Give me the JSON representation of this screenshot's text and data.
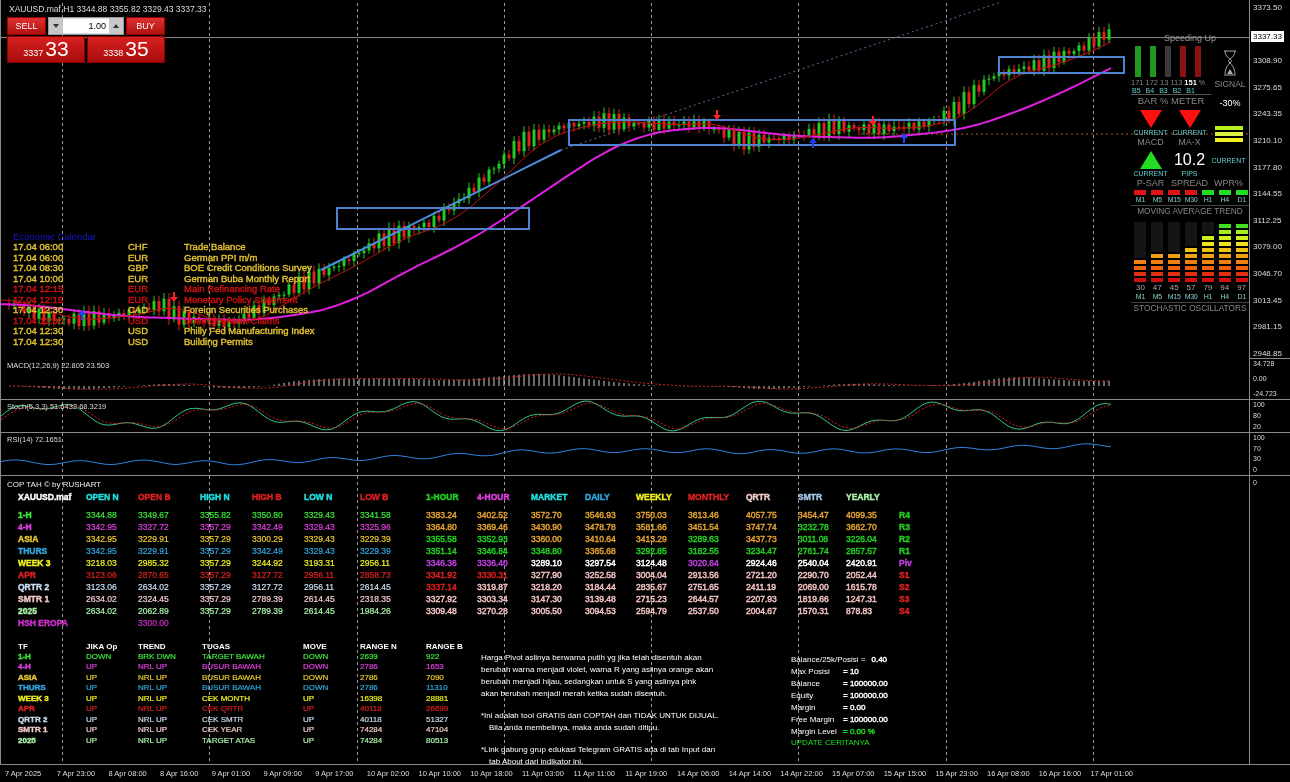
{
  "chart": {
    "symbol": "XAUUSD.maf,H1",
    "ohlc": "3344.88 3355.82 3329.43 3337.33",
    "current_price": "3337.33",
    "price_axis": [
      "3373.50",
      "3308.90",
      "3275.65",
      "3243.35",
      "3210.10",
      "3177.80",
      "3144.55",
      "3112.25",
      "3079.00",
      "3046.70",
      "3013.45",
      "2981.15",
      "2948.85"
    ]
  },
  "trade": {
    "sell": "SELL",
    "buy": "BUY",
    "lot": "1.00",
    "bid_main": "3337",
    "bid_big": "33",
    "ask_main": "3338",
    "ask_big": "35"
  },
  "calendar": {
    "title": "Economic Calendar",
    "events": [
      {
        "time": "17.04 06:00",
        "currency": "CHF",
        "event": "Trade Balance",
        "color": "#e0c030"
      },
      {
        "time": "17.04 06:00",
        "currency": "EUR",
        "event": "German PPI m/m",
        "color": "#e0c030"
      },
      {
        "time": "17.04 08:30",
        "currency": "GBP",
        "event": "BOE Credit Conditions Survey",
        "color": "#e0c030"
      },
      {
        "time": "17.04 10:00",
        "currency": "EUR",
        "event": "German Buba Monthly Report",
        "color": "#e0c030"
      },
      {
        "time": "17.04 12:15",
        "currency": "EUR",
        "event": "Main Refinancing Rate",
        "color": "#d01010"
      },
      {
        "time": "17.04 12:15",
        "currency": "EUR",
        "event": "Monetary Policy Statement",
        "color": "#d01010"
      },
      {
        "time": "17.04 12:30",
        "currency": "CAD",
        "event": "Foreign Securities Purchases",
        "color": "#e0c030"
      },
      {
        "time": "17.04 12:30",
        "currency": "USD",
        "event": "Unemployment Claims",
        "color": "#d01010"
      },
      {
        "time": "17.04 12:30",
        "currency": "USD",
        "event": "Philly Fed Manufacturing Index",
        "color": "#e0c030"
      },
      {
        "time": "17.04 12:30",
        "currency": "USD",
        "event": "Building Permits",
        "color": "#e0c030"
      }
    ]
  },
  "dashboard": {
    "status": "Speeding Up",
    "bar_meter": {
      "title": "BAR % METER",
      "unit": "%",
      "bars": [
        {
          "label": "B5",
          "value": "171",
          "color": "#1f9a1f",
          "highlight": false
        },
        {
          "label": "B4",
          "value": "172",
          "color": "#1f9a1f",
          "highlight": false
        },
        {
          "label": "B3",
          "value": "13",
          "color": "#3a3a3a",
          "highlight": false
        },
        {
          "label": "B2",
          "value": "113",
          "color": "#8a1212",
          "highlight": false
        },
        {
          "label": "B1",
          "value": "151",
          "color": "#8a1212",
          "highlight": true
        }
      ]
    },
    "signal": {
      "label": "SIGNAL",
      "value": "-30%"
    },
    "signals": [
      {
        "kind": "arrow",
        "rising": false,
        "caption": "CURRENT",
        "name": "MACD"
      },
      {
        "kind": "arrow",
        "rising": false,
        "caption": "CURRENT",
        "name": "MA-X"
      },
      {
        "kind": "arrow",
        "rising": true,
        "caption": "CURRENT",
        "name": "P-SAR"
      },
      {
        "kind": "value",
        "value": "10.2",
        "caption": "PIPS",
        "name": "SPREAD"
      },
      {
        "kind": "stripes",
        "caption": "CURRENT",
        "name": "WPR%"
      }
    ],
    "ma_trend": {
      "title": "MOVING AVERAGE TREND",
      "frames": [
        {
          "label": "M1",
          "color": "#e01515"
        },
        {
          "label": "M5",
          "color": "#e01515"
        },
        {
          "label": "M15",
          "color": "#e01515"
        },
        {
          "label": "M30",
          "color": "#e01515"
        },
        {
          "label": "H1",
          "color": "#22dd22"
        },
        {
          "label": "H4",
          "color": "#22dd22"
        },
        {
          "label": "D1",
          "color": "#22dd22"
        }
      ]
    },
    "stochastic": {
      "title": "STOCHASTIC OSCILLATORS",
      "frames": [
        {
          "label": "M1",
          "value": "30",
          "level": 0.4
        },
        {
          "label": "M5",
          "value": "47",
          "level": 0.5
        },
        {
          "label": "M15",
          "value": "45",
          "level": 0.5
        },
        {
          "label": "M30",
          "value": "57",
          "level": 0.6
        },
        {
          "label": "H1",
          "value": "79",
          "level": 0.8
        },
        {
          "label": "H4",
          "value": "94",
          "level": 1.0
        },
        {
          "label": "D1",
          "value": "97",
          "level": 1.0
        }
      ]
    }
  },
  "indicators": [
    {
      "kind": "macd",
      "label": "MACD(12,26,9) 22.805 23.503",
      "axis": [
        "34.728",
        "0.00",
        "-24.723"
      ]
    },
    {
      "kind": "stoch",
      "label": "Stoch(5,3,3) 51.6432 68.3219",
      "axis": [
        "100",
        "80",
        "20"
      ]
    },
    {
      "kind": "rsi",
      "label": "RSI(14) 72.1651",
      "axis": [
        "100",
        "70",
        "30",
        "0"
      ]
    }
  ],
  "pivot_table": {
    "title": "COP TAH © by RUSHART",
    "columns": [
      {
        "label": "XAUUSD.maf",
        "color": "#ffffff"
      },
      {
        "label": "OPEN N",
        "color": "#20e0e0"
      },
      {
        "label": "OPEN B",
        "color": "#e02020"
      },
      {
        "label": "HIGH N",
        "color": "#20e0e0"
      },
      {
        "label": "HIGH B",
        "color": "#e02020"
      },
      {
        "label": "LOW N",
        "color": "#20e0e0"
      },
      {
        "label": "LOW B",
        "color": "#e02020"
      },
      {
        "label": "1-HOUR",
        "color": "#20d020"
      },
      {
        "label": "4-HOUR",
        "color": "#e040e0"
      },
      {
        "label": "MARKET",
        "color": "#20e0e0"
      },
      {
        "label": "DAILY",
        "color": "#30a8e0"
      },
      {
        "label": "WEEKLY",
        "color": "#f0f020"
      },
      {
        "label": "MONTHLY",
        "color": "#e02020"
      },
      {
        "label": "QRTR",
        "color": "#f0c8c8"
      },
      {
        "label": "SMTR",
        "color": "#a8c8f0"
      },
      {
        "label": "YEARLY",
        "color": "#a8f0a8"
      }
    ],
    "rows": [
      {
        "label": "1-H",
        "color": "#3ce63c",
        "values": [
          "3344.88",
          "3349.67",
          "3355.82",
          "3350.80",
          "3329.43",
          "3341.58"
        ],
        "pivots": [
          {
            "value": "3383.24",
            "color": "#e0a030"
          },
          {
            "value": "3402.52",
            "color": "#e0a030"
          },
          {
            "value": "3572.70",
            "color": "#e0a030"
          },
          {
            "value": "3546.93",
            "color": "#e0a030"
          },
          {
            "value": "3750.03",
            "color": "#e0a030"
          },
          {
            "value": "3613.46",
            "color": "#e0a030"
          },
          {
            "value": "4057.75",
            "color": "#e0a030"
          },
          {
            "value": "3454.47",
            "color": "#e0a030"
          },
          {
            "value": "4099.35",
            "color": "#e0a030"
          }
        ],
        "level": {
          "text": "R4",
          "color": "#20d020"
        }
      },
      {
        "label": "4-H",
        "color": "#e040e0",
        "values": [
          "3342.95",
          "3327.72",
          "3357.29",
          "3342.49",
          "3329.43",
          "3325.96"
        ],
        "pivots": [
          {
            "value": "3364.80",
            "color": "#e0a030"
          },
          {
            "value": "3369.46",
            "color": "#e0a030"
          },
          {
            "value": "3430.90",
            "color": "#e0a030"
          },
          {
            "value": "3478.78",
            "color": "#e0a030"
          },
          {
            "value": "3581.66",
            "color": "#e0a030"
          },
          {
            "value": "3451.54",
            "color": "#e0a030"
          },
          {
            "value": "3747.74",
            "color": "#e0a030"
          },
          {
            "value": "3232.78",
            "color": "#20d020"
          },
          {
            "value": "3662.70",
            "color": "#e0a030"
          }
        ],
        "level": {
          "text": "R3",
          "color": "#20d020"
        }
      },
      {
        "label": "ASIA",
        "color": "#e8c830",
        "values": [
          "3342.95",
          "3229.91",
          "3357.29",
          "3300.29",
          "3329.43",
          "3229.39"
        ],
        "pivots": [
          {
            "value": "3355.58",
            "color": "#20d020"
          },
          {
            "value": "3352.93",
            "color": "#20d020"
          },
          {
            "value": "3360.00",
            "color": "#e0a030"
          },
          {
            "value": "3410.64",
            "color": "#e0a030"
          },
          {
            "value": "3413.29",
            "color": "#e0a030"
          },
          {
            "value": "3289.63",
            "color": "#20d020"
          },
          {
            "value": "3437.73",
            "color": "#e0a030"
          },
          {
            "value": "3011.08",
            "color": "#20d020"
          },
          {
            "value": "3226.04",
            "color": "#20d020"
          }
        ],
        "level": {
          "text": "R2",
          "color": "#20d020"
        }
      },
      {
        "label": "THURS",
        "color": "#30a8e0",
        "values": [
          "3342.95",
          "3229.91",
          "3357.29",
          "3342.49",
          "3329.43",
          "3229.39"
        ],
        "pivots": [
          {
            "value": "3351.14",
            "color": "#20d020"
          },
          {
            "value": "3346.84",
            "color": "#20d020"
          },
          {
            "value": "3348.80",
            "color": "#20d020"
          },
          {
            "value": "3365.68",
            "color": "#e0a030"
          },
          {
            "value": "3292.85",
            "color": "#20d020"
          },
          {
            "value": "3182.55",
            "color": "#20d020"
          },
          {
            "value": "3234.47",
            "color": "#20d020"
          },
          {
            "value": "2761.74",
            "color": "#20d020"
          },
          {
            "value": "2857.57",
            "color": "#20d020"
          }
        ],
        "level": {
          "text": "R1",
          "color": "#20d020"
        }
      },
      {
        "label": "WEEK 3",
        "color": "#f0f020",
        "values": [
          "3218.03",
          "2985.32",
          "3357.29",
          "3244.92",
          "3193.31",
          "2956.11"
        ],
        "pivots": [
          {
            "value": "3346.36",
            "color": "#c040e0"
          },
          {
            "value": "3336.40",
            "color": "#c040e0"
          },
          {
            "value": "3289.10",
            "color": "#ffffff"
          },
          {
            "value": "3297.54",
            "color": "#ffffff"
          },
          {
            "value": "3124.48",
            "color": "#ffffff"
          },
          {
            "value": "3020.64",
            "color": "#c040e0"
          },
          {
            "value": "2924.46",
            "color": "#ffffff"
          },
          {
            "value": "2540.04",
            "color": "#ffffff"
          },
          {
            "value": "2420.91",
            "color": "#ffffff"
          }
        ],
        "level": {
          "text": "Piv",
          "color": "#c040e0"
        }
      },
      {
        "label": "APR",
        "color": "#e02020",
        "values": [
          "3123.06",
          "2870.65",
          "3357.29",
          "3127.72",
          "2956.11",
          "2858.73"
        ],
        "pivots": [
          {
            "value": "3341.92",
            "color": "#e02020"
          },
          {
            "value": "3330.31",
            "color": "#e02020"
          },
          {
            "value": "3277.90",
            "color": "#f0c0c0"
          },
          {
            "value": "3252.58",
            "color": "#f0c0c0"
          },
          {
            "value": "3004.04",
            "color": "#f0c0c0"
          },
          {
            "value": "2913.56",
            "color": "#f0c0c0"
          },
          {
            "value": "2721.20",
            "color": "#f0c0c0"
          },
          {
            "value": "2290.70",
            "color": "#f0c0c0"
          },
          {
            "value": "2052.44",
            "color": "#f0c0c0"
          }
        ],
        "level": {
          "text": "S1",
          "color": "#e02020"
        }
      },
      {
        "label": "QRTR 2",
        "color": "#c8dcf0",
        "values": [
          "3123.06",
          "2634.02",
          "3357.29",
          "3127.72",
          "2956.11",
          "2614.45"
        ],
        "pivots": [
          {
            "value": "3337.14",
            "color": "#e02020"
          },
          {
            "value": "3319.87",
            "color": "#f0c0c0"
          },
          {
            "value": "3218.20",
            "color": "#f0c0c0"
          },
          {
            "value": "3184.44",
            "color": "#f0c0c0"
          },
          {
            "value": "2835.67",
            "color": "#f0c0c0"
          },
          {
            "value": "2751.65",
            "color": "#f0c0c0"
          },
          {
            "value": "2411.19",
            "color": "#f0c0c0"
          },
          {
            "value": "2069.00",
            "color": "#f0c0c0"
          },
          {
            "value": "1615.78",
            "color": "#f0c0c0"
          }
        ],
        "level": {
          "text": "S2",
          "color": "#e02020"
        }
      },
      {
        "label": "SMTR 1",
        "color": "#f0c8c8",
        "values": [
          "2634.02",
          "2324.45",
          "3357.29",
          "2789.39",
          "2614.45",
          "2318.35"
        ],
        "pivots": [
          {
            "value": "3327.92",
            "color": "#f0c0c0"
          },
          {
            "value": "3303.34",
            "color": "#f0c0c0"
          },
          {
            "value": "3147.30",
            "color": "#f0c0c0"
          },
          {
            "value": "3139.48",
            "color": "#f0c0c0"
          },
          {
            "value": "2715.23",
            "color": "#f0c0c0"
          },
          {
            "value": "2644.57",
            "color": "#f0c0c0"
          },
          {
            "value": "2207.93",
            "color": "#f0c0c0"
          },
          {
            "value": "1819.66",
            "color": "#f0c0c0"
          },
          {
            "value": "1247.31",
            "color": "#f0c0c0"
          }
        ],
        "level": {
          "text": "S3",
          "color": "#e02020"
        }
      },
      {
        "label": "2025",
        "color": "#a8f0a8",
        "values": [
          "2634.02",
          "2062.89",
          "3357.29",
          "2789.39",
          "2614.45",
          "1984.26"
        ],
        "pivots": [
          {
            "value": "3309.48",
            "color": "#f0c0c0"
          },
          {
            "value": "3270.28",
            "color": "#f0c0c0"
          },
          {
            "value": "3005.50",
            "color": "#f0c0c0"
          },
          {
            "value": "3094.53",
            "color": "#f0c0c0"
          },
          {
            "value": "2594.79",
            "color": "#f0c0c0"
          },
          {
            "value": "2537.50",
            "color": "#f0c0c0"
          },
          {
            "value": "2004.67",
            "color": "#f0c0c0"
          },
          {
            "value": "1570.31",
            "color": "#f0c0c0"
          },
          {
            "value": "878.83",
            "color": "#f0c0c0"
          }
        ],
        "level": {
          "text": "S4",
          "color": "#e02020"
        }
      },
      {
        "label": "HSH EROPA",
        "color": "#d030d0",
        "open_b": "3300.00"
      }
    ]
  },
  "plan_table": {
    "columns": [
      "TF",
      "JIKA Op",
      "TREND",
      "TUGAS",
      "MOVE",
      "RANGE N",
      "RANGE B"
    ],
    "rows": [
      {
        "color": "#3ce63c",
        "cells": [
          "1-H",
          "DOWN",
          "BRK DWN",
          "TARGET BAWAH",
          "DOWN",
          "2639",
          "922"
        ]
      },
      {
        "color": "#e040e0",
        "cells": [
          "4-H",
          "UP",
          "NRL UP",
          "BUSUR BAWAH",
          "DOWN",
          "2786",
          "1653"
        ]
      },
      {
        "color": "#e8c830",
        "cells": [
          "ASIA",
          "UP",
          "NRL UP",
          "BUSUR BAWAH",
          "DOWN",
          "2786",
          "7090"
        ]
      },
      {
        "color": "#30a8e0",
        "cells": [
          "THURS",
          "UP",
          "NRL UP",
          "BUSUR BAWAH",
          "DOWN",
          "2786",
          "11310"
        ]
      },
      {
        "color": "#f0f020",
        "cells": [
          "WEEK 3",
          "UP",
          "NRL UP",
          "CEK MONTH",
          "UP",
          "16398",
          "28881"
        ]
      },
      {
        "color": "#e02020",
        "cells": [
          "APR",
          "UP",
          "NRL UP",
          "CEK QRTR",
          "UP",
          "40118",
          "26699"
        ]
      },
      {
        "color": "#c8dcf0",
        "cells": [
          "QRTR 2",
          "UP",
          "NRL UP",
          "CEK SMTR",
          "UP",
          "40118",
          "51327"
        ]
      },
      {
        "color": "#f0c8c8",
        "cells": [
          "SMTR 1",
          "UP",
          "NRL UP",
          "CEK YEAR",
          "UP",
          "74284",
          "47104"
        ]
      },
      {
        "color": "#a8f0a8",
        "cells": [
          "2025",
          "UP",
          "NRL UP",
          "TARGET ATAS",
          "UP",
          "74284",
          "80513"
        ]
      }
    ]
  },
  "notes": [
    {
      "hanging": false,
      "lines": [
        "Harga Pivot aslinya berwarna putih yg jika telah disentuh akan",
        "berubah warna menjadi violet, warna R yang aslinya orange akan",
        "berubah menjadi hijau, sedangkan untuk S yang aslinya pink",
        "akan berubah menjadi merah ketika sudah disentuh."
      ]
    },
    {
      "hanging": true,
      "lines": [
        "*Ini adalah tool GRATIS dari COPTAH dan TIDAK UNTUK DIJUAL.",
        "Bila anda membelinya, maka anda sudah ditipu."
      ]
    },
    {
      "hanging": true,
      "lines": [
        "*Link gabung grup edukasi Telegram GRATIS ada di tab Input dan",
        "tab About dari indikator ini."
      ]
    }
  ],
  "account": {
    "rows": [
      {
        "label": "Balance/25k/Posisi =",
        "value": "0.40",
        "color": "#ffffff"
      },
      {
        "label": "Max Posisi",
        "value": "= 10",
        "color": "#ffffff"
      },
      {
        "label": "Balance",
        "value": "= 100000.00",
        "color": "#ffffff"
      },
      {
        "label": "Equity",
        "value": "= 100000.00",
        "color": "#ffffff"
      },
      {
        "label": "Margin",
        "value": "= 0.00",
        "color": "#ffffff"
      },
      {
        "label": "Free Margin",
        "value": "= 100000.00",
        "color": "#ffffff"
      },
      {
        "label": "Margin Level",
        "value": "= 0.00 %",
        "color": "#20e020"
      }
    ],
    "link": "UPDATE CERITANYA"
  },
  "bottom_axis": "0",
  "time_axis": [
    "7 Apr 2025",
    "7 Apr 23:00",
    "8 Apr 08:00",
    "8 Apr 16:00",
    "9 Apr 01:00",
    "9 Apr 09:00",
    "9 Apr 17:00",
    "10 Apr 02:00",
    "10 Apr 10:00",
    "10 Apr 18:00",
    "11 Apr 03:00",
    "11 Apr 11:00",
    "11 Apr 19:00",
    "14 Apr 06:00",
    "14 Apr 14:00",
    "14 Apr 22:00",
    "15 Apr 07:00",
    "15 Apr 15:00",
    "15 Apr 23:00",
    "16 Apr 08:00",
    "16 Apr 16:00",
    "17 Apr 01:00"
  ]
}
